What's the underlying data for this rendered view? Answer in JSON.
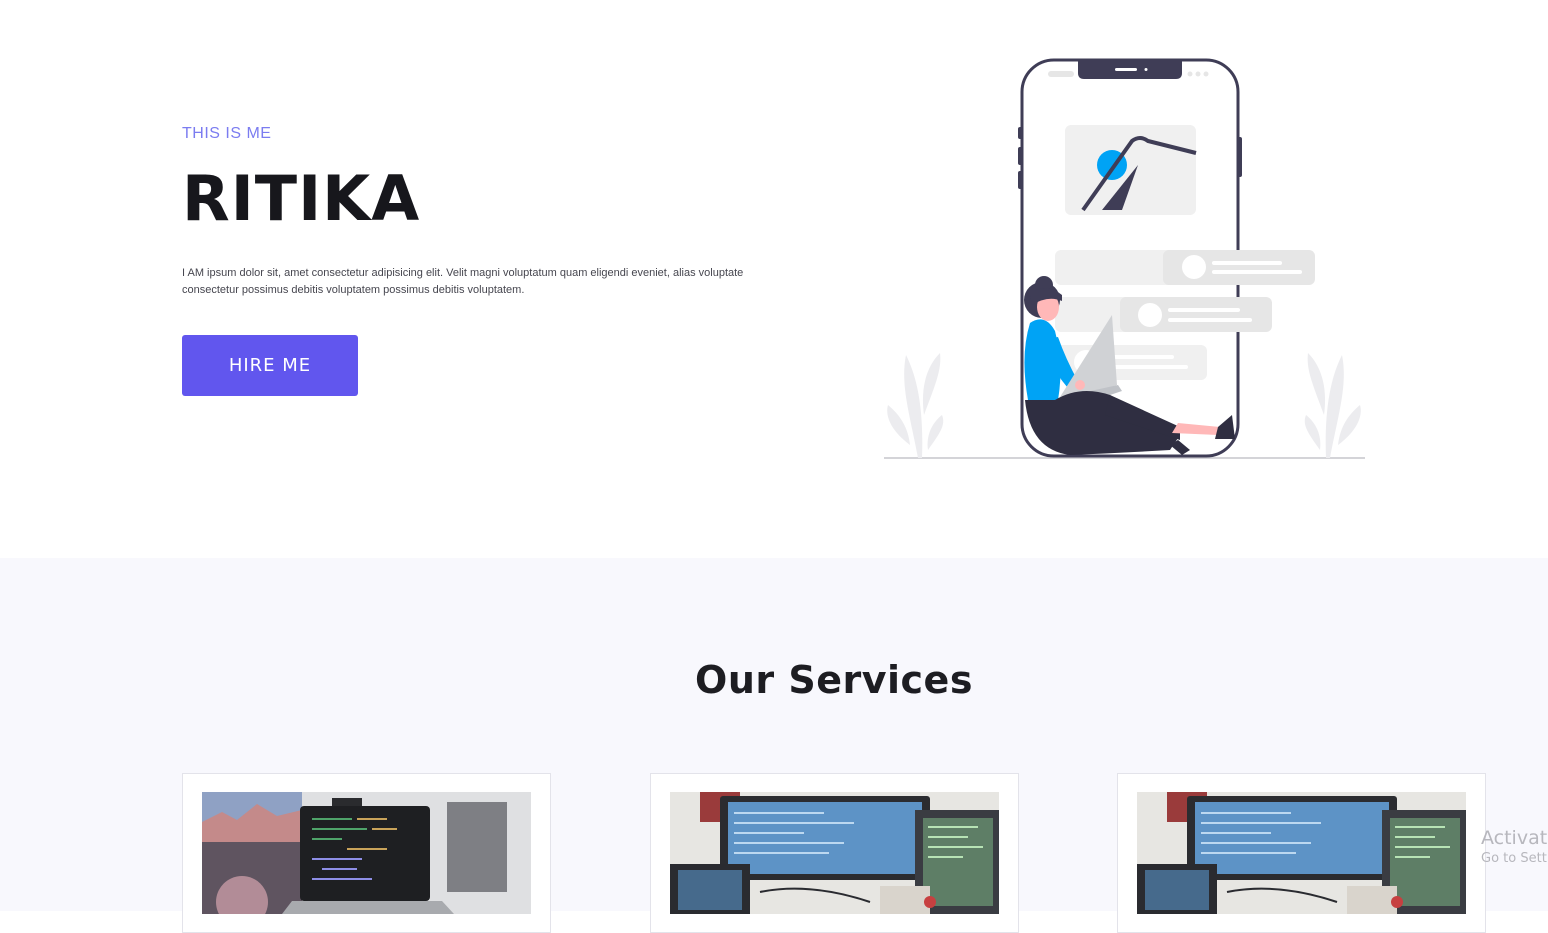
{
  "hero": {
    "eyebrow": "THIS IS ME",
    "name": "RITIKA",
    "description": "I AM ipsum dolor sit, amet consectetur adipisicing elit. Velit magni voluptatum quam eligendi eveniet, alias voluptate consectetur possimus debitis voluptatem possimus debitis voluptatem.",
    "cta_label": "HIRE ME",
    "illustration_icon": "person-with-laptop-and-phone-illustration"
  },
  "services": {
    "title": "Our Services",
    "cards": [
      {
        "image_icon": "laptop-code-photo"
      },
      {
        "image_icon": "monitors-code-photo"
      },
      {
        "image_icon": "monitors-code-photo"
      }
    ]
  },
  "watermark": {
    "title": "Activate",
    "subtitle": "Go to Sett"
  },
  "colors": {
    "accent": "#6156ee",
    "eyebrow": "#7b7cf0",
    "figure_shirt": "#00a3f5",
    "dark": "#3f3d56",
    "section_bg": "#f8f8fd"
  }
}
